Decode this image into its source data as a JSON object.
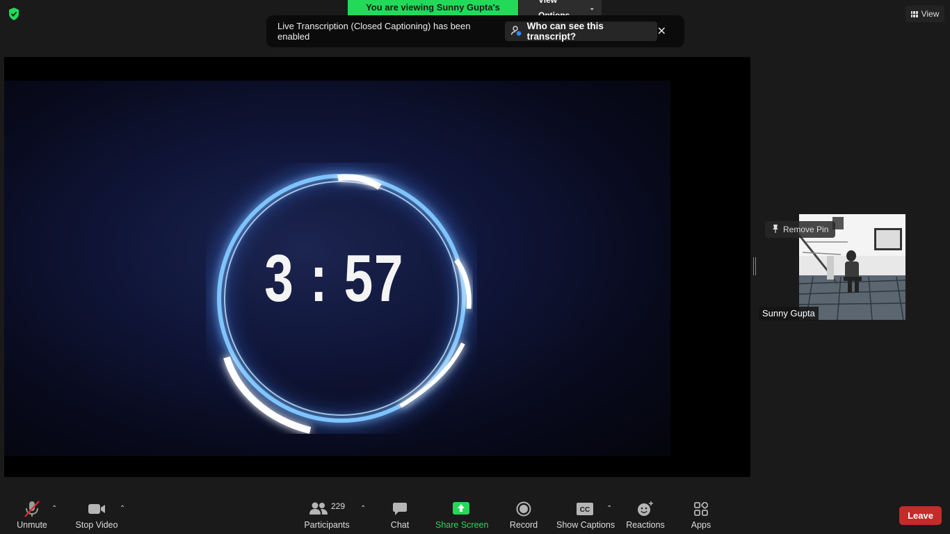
{
  "banner": {
    "viewing_text": "You are viewing Sunny Gupta's screen",
    "view_options": "View Options"
  },
  "top_right": {
    "view_label": "View"
  },
  "toast": {
    "message": "Live Transcription (Closed Captioning) has been enabled",
    "who_button": "Who can see this transcript?"
  },
  "shared_screen": {
    "timer": "3 : 57"
  },
  "participant": {
    "name": "Sunny Gupta",
    "remove_pin": "Remove Pin"
  },
  "toolbar": {
    "unmute": "Unmute",
    "stop_video": "Stop Video",
    "participants": "Participants",
    "participant_count": "229",
    "chat": "Chat",
    "share_screen": "Share Screen",
    "record": "Record",
    "show_captions": "Show Captions",
    "reactions": "Reactions",
    "apps": "Apps",
    "leave": "Leave"
  },
  "colors": {
    "accent_green": "#23d959",
    "leave_red": "#c42b2b",
    "background": "#1a1a1a"
  },
  "icons": [
    "shield-check-icon",
    "grid-icon",
    "person-info-icon",
    "close-icon",
    "pin-icon",
    "mic-muted-icon",
    "camera-icon",
    "participants-icon",
    "chat-bubble-icon",
    "share-up-arrow-icon",
    "record-icon",
    "cc-icon",
    "emoji-plus-icon",
    "apps-icon",
    "caret-up-icon"
  ]
}
